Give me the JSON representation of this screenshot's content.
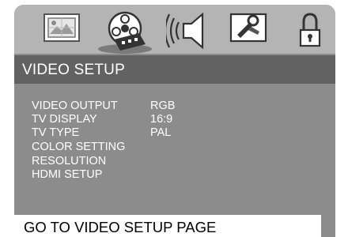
{
  "tabs": [
    {
      "icon": "general-setup-icon"
    },
    {
      "icon": "video-film-reel-icon"
    },
    {
      "icon": "audio-speaker-icon"
    },
    {
      "icon": "preference-tools-icon"
    },
    {
      "icon": "password-lock-icon"
    }
  ],
  "page": {
    "title": "VIDEO SETUP"
  },
  "menu": {
    "items": [
      {
        "label": "VIDEO OUTPUT",
        "value": "RGB"
      },
      {
        "label": "TV DISPLAY",
        "value": "16:9"
      },
      {
        "label": "TV TYPE",
        "value": "PAL"
      },
      {
        "label": "COLOR SETTING",
        "value": ""
      },
      {
        "label": "RESOLUTION",
        "value": ""
      },
      {
        "label": "HDMI SETUP",
        "value": ""
      }
    ]
  },
  "hint": {
    "text": "GO TO VIDEO SETUP PAGE"
  },
  "colors": {
    "frame": "#8c8c8c",
    "tabbar": "#b4b4b4",
    "titlebar": "#626262",
    "text": "#ffffff",
    "hint_bg": "#ffffff"
  }
}
